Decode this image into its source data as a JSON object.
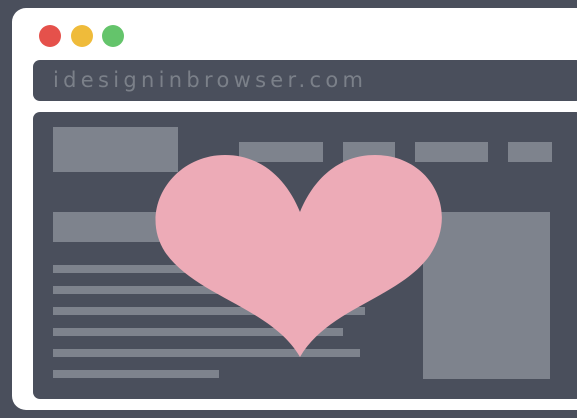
{
  "url_bar": {
    "text": "idesigninbrowser.com"
  },
  "window_controls": [
    {
      "name": "close-dot",
      "color": "#e5514b"
    },
    {
      "name": "minimize-dot",
      "color": "#efbb3a"
    },
    {
      "name": "maximize-dot",
      "color": "#64c46b"
    }
  ],
  "colors": {
    "frame": "#4a4f5c",
    "window": "#ffffff",
    "placeholder": "#7e838d",
    "heart": "#edabb7"
  },
  "icons": {
    "heart": "heart-icon"
  }
}
